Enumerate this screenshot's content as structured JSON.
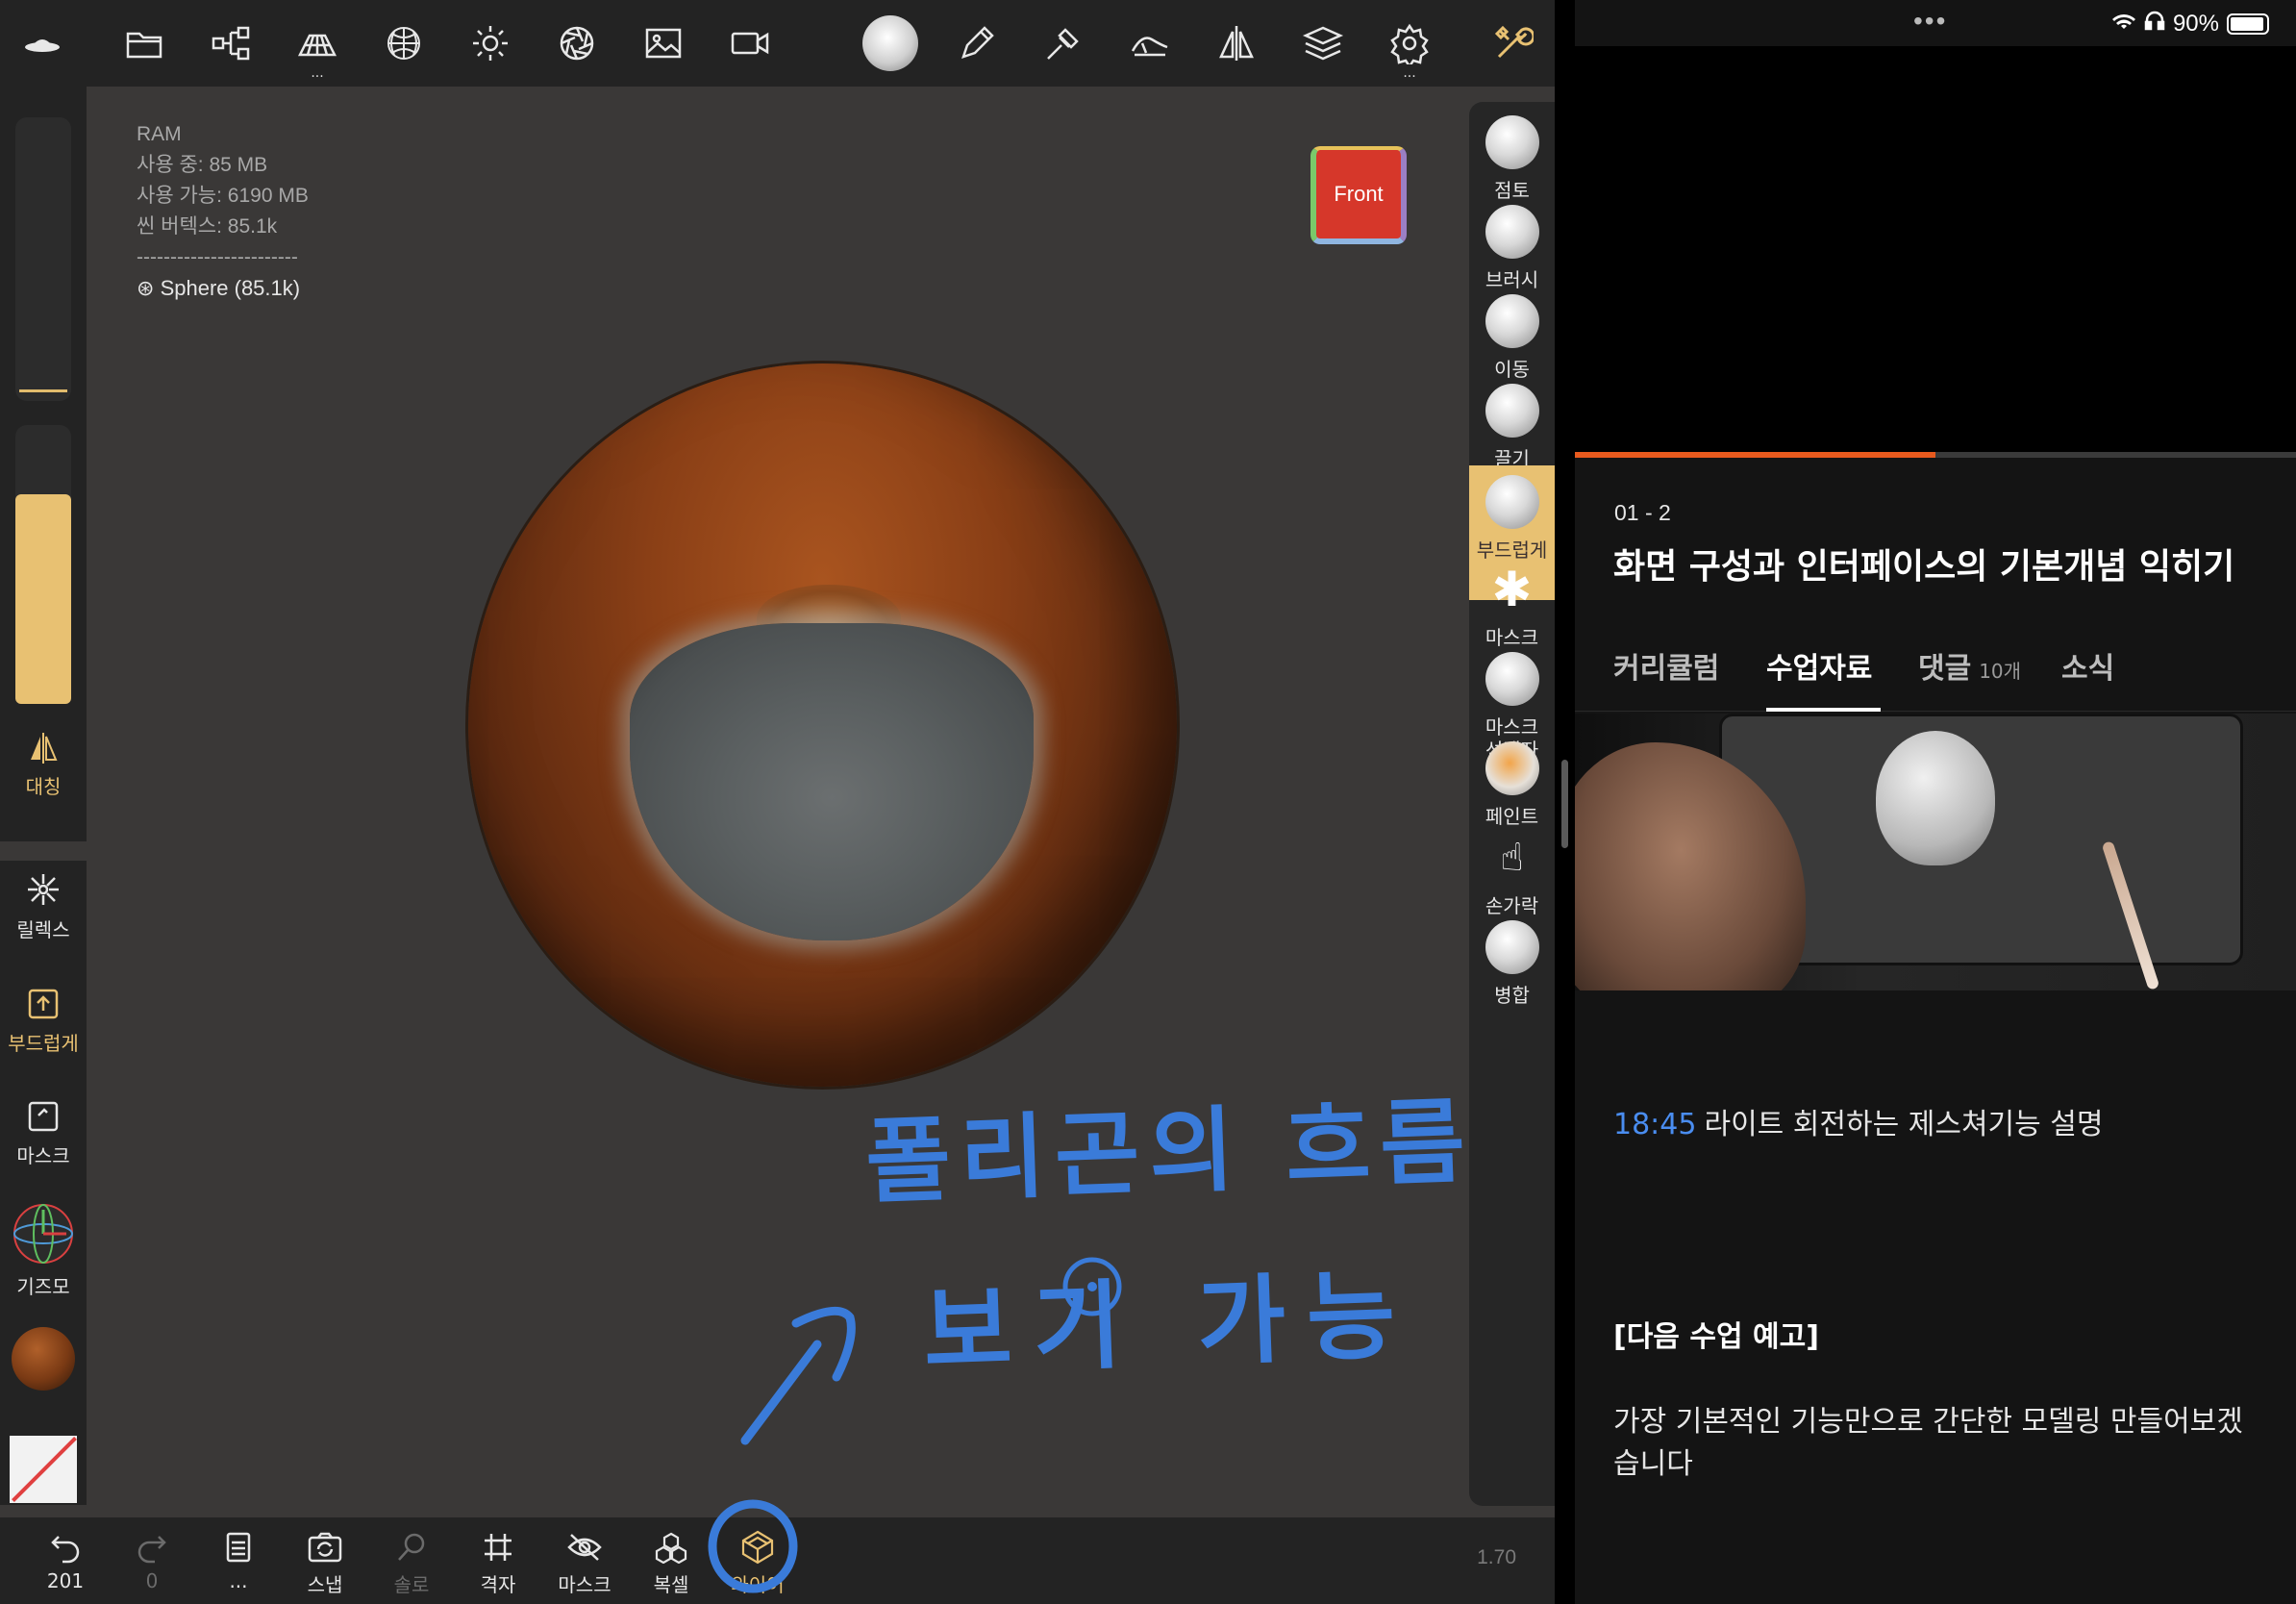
{
  "left_app": {
    "stats": {
      "ram_label": "RAM",
      "in_use": "사용 중: 85 MB",
      "available": "사용 가능: 6190 MB",
      "scene_vertex": "씬 버텍스: 85.1k",
      "separator": "------------------------",
      "object": "Sphere (85.1k)"
    },
    "view_cube_label": "Front",
    "left_buttons": {
      "symmetry": "대칭",
      "relax": "릴렉스",
      "smooth": "부드럽게",
      "mask": "마스크",
      "gizmo": "기즈모"
    },
    "tools": [
      {
        "label": "점토"
      },
      {
        "label": "브러시"
      },
      {
        "label": "이동"
      },
      {
        "label": "끌기"
      },
      {
        "label": "부드럽게"
      },
      {
        "label": "마스크"
      },
      {
        "label": "마스크\n선택자"
      },
      {
        "label": "페인트"
      },
      {
        "label": "손가락"
      },
      {
        "label": "병합"
      }
    ],
    "active_tool": "부드럽게",
    "bottom": {
      "undo_count": "201",
      "redo_count": "0",
      "more": "...",
      "snap": "스냅",
      "solo": "솔로",
      "grid": "격자",
      "mask": "마스크",
      "instance": "복셀",
      "wireframe": "와이어"
    },
    "version": "1.70",
    "handwriting": {
      "line1": "폴리곤의 흐름",
      "line2": "보기 가능"
    },
    "colors": {
      "accent": "#e8c172",
      "ink": "#3a7bd9"
    }
  },
  "right_app": {
    "status": {
      "dots": "•••",
      "battery": "90%"
    },
    "progress": 0.5,
    "lesson_number": "01 - 2",
    "lesson_title": "화면 구성과 인터페이스의 기본개념 익히기",
    "tabs": [
      {
        "label": "커리큘럼",
        "count": ""
      },
      {
        "label": "수업자료",
        "count": ""
      },
      {
        "label": "댓글",
        "count": "10개"
      },
      {
        "label": "소식",
        "count": ""
      }
    ],
    "active_tab": "수업자료",
    "note": {
      "time": "18:45",
      "text": "라이트 회전하는 제스쳐기능 설명"
    },
    "next_heading": "[다음 수업 예고]",
    "next_body": "가장 기본적인 기능만으로 간단한 모델링 만들어보겠습니다",
    "colors": {
      "progress": "#e85a1e",
      "timestamp": "#4a8df0"
    }
  }
}
